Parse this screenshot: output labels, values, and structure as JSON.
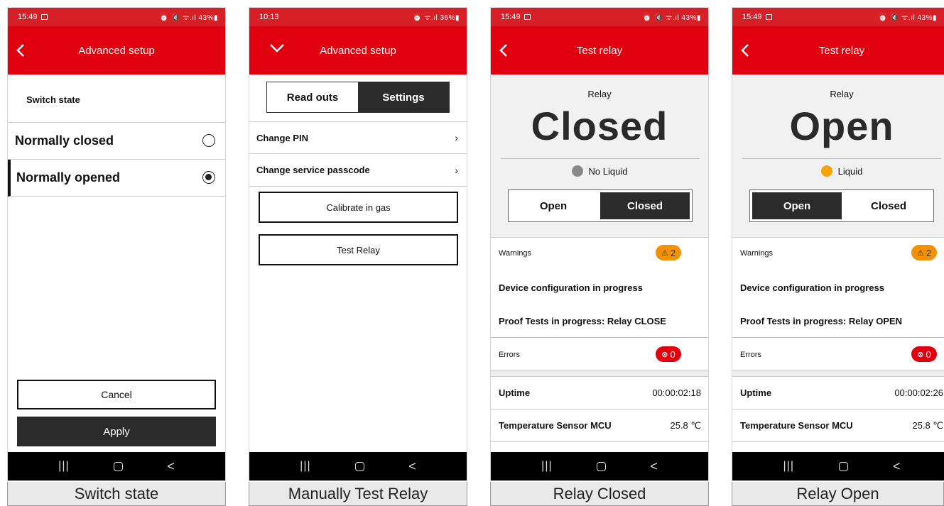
{
  "panels": [
    {
      "status": {
        "time": "15:49",
        "right": "⏰ 🔇 ᯤ.ıl 43%▮"
      },
      "header": {
        "title": "Advanced setup"
      },
      "section_title": "Switch state",
      "options": [
        {
          "label": "Normally closed",
          "selected": false
        },
        {
          "label": "Normally opened",
          "selected": true
        }
      ],
      "cancel": "Cancel",
      "apply": "Apply",
      "caption": "Switch state"
    },
    {
      "status": {
        "time": "10:13",
        "right": "⏰ ᯤ.ıl 36%▮"
      },
      "header": {
        "title": "Advanced setup"
      },
      "tabs": [
        "Read outs",
        "Settings"
      ],
      "rows": [
        "Change PIN",
        "Change service passcode"
      ],
      "buttons": [
        "Calibrate in gas",
        "Test Relay"
      ],
      "caption": "Manually Test Relay"
    },
    {
      "status": {
        "time": "15:49",
        "right": "⏰ 🔇 ᯤ.ıl 43%▮"
      },
      "header": {
        "title": "Test relay"
      },
      "relay_label": "Relay",
      "relay_state": "Closed",
      "liquid": {
        "label": "No Liquid",
        "color": "#888888"
      },
      "seg": [
        "Open",
        "Closed"
      ],
      "seg_active": 1,
      "warnings_label": "Warnings",
      "warnings_count": "2",
      "messages": [
        "Device configuration in progress",
        "Proof Tests in progress: Relay CLOSE"
      ],
      "errors_label": "Errors",
      "errors_count": "0",
      "uptime": {
        "label": "Uptime",
        "value": "00:00:02:18"
      },
      "temp": {
        "label": "Temperature Sensor MCU",
        "value": "25.8 ℃"
      },
      "caption": "Relay Closed"
    },
    {
      "status": {
        "time": "15:49",
        "right": "⏰ 🔇 ᯤ.ıl 43%▮"
      },
      "header": {
        "title": "Test relay"
      },
      "relay_label": "Relay",
      "relay_state": "Open",
      "liquid": {
        "label": "Liquid",
        "color": "#f5a400"
      },
      "seg": [
        "Open",
        "Closed"
      ],
      "seg_active": 0,
      "warnings_label": "Warnings",
      "warnings_count": "2",
      "messages": [
        "Device configuration in progress",
        "Proof Tests in progress: Relay OPEN"
      ],
      "errors_label": "Errors",
      "errors_count": "0",
      "uptime": {
        "label": "Uptime",
        "value": "00:00:02:26"
      },
      "temp": {
        "label": "Temperature Sensor MCU",
        "value": "25.8 ℃"
      },
      "caption": "Relay Open"
    }
  ],
  "nav": {
    "recent": "|||",
    "back": "<"
  }
}
